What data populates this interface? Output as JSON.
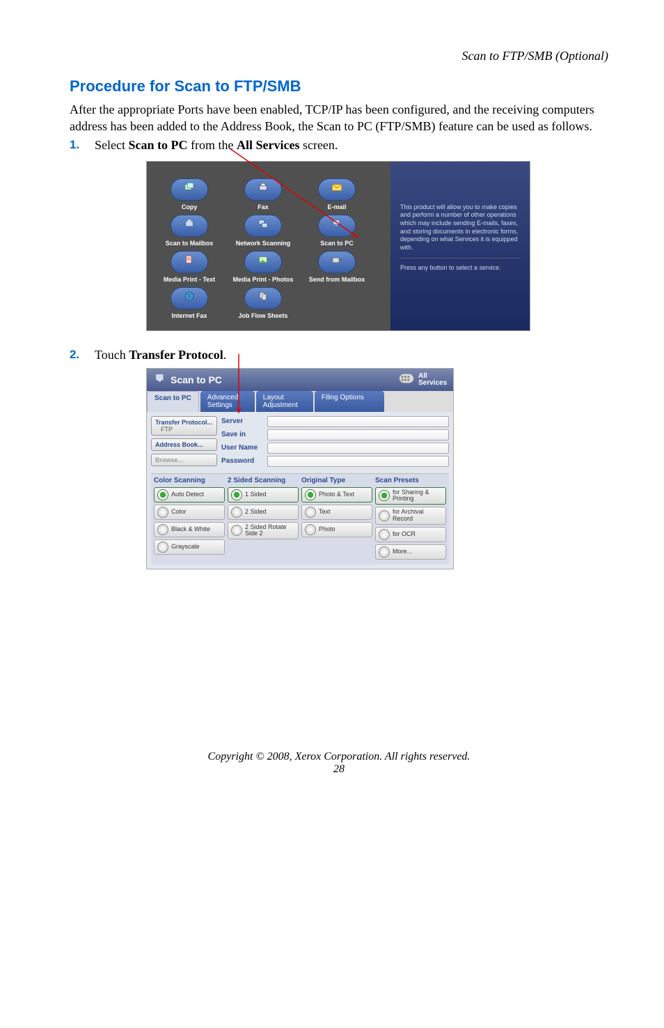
{
  "header": {
    "breadcrumb": "Scan to FTP/SMB (Optional)"
  },
  "section": {
    "title": "Procedure for Scan to FTP/SMB",
    "intro": "After the appropriate Ports have been enabled, TCP/IP has been configured, and the receiving computers address has been added to the Address Book, the Scan to PC (FTP/SMB) feature can be used as follows."
  },
  "steps": {
    "s1": {
      "num": "1.",
      "pre": "Select ",
      "bold1": "Scan to PC",
      "mid": " from the ",
      "bold2": "All Services",
      "post": " screen."
    },
    "s2": {
      "num": "2.",
      "pre": "Touch ",
      "bold1": "Transfer Protocol",
      "post": "."
    }
  },
  "all_services": {
    "items": [
      {
        "label": "Copy"
      },
      {
        "label": "Fax"
      },
      {
        "label": "E-mail"
      },
      {
        "label": "Scan to Mailbox"
      },
      {
        "label": "Network Scanning"
      },
      {
        "label": "Scan to PC"
      },
      {
        "label": "Media Print - Text"
      },
      {
        "label": "Media Print - Photos"
      },
      {
        "label": "Send from Mailbox"
      },
      {
        "label": "Internet Fax"
      },
      {
        "label": "Job Flow Sheets"
      }
    ],
    "info1": "This product will allow you to make copies and perform a number of other operations which may include sending E-mails, faxes, and storing documents in electronic forms, depending on what Services it is equipped with.",
    "info2": "Press any button to select a service."
  },
  "scan_pc": {
    "title": "Scan to PC",
    "all_services_btn": "All Services",
    "tabs": [
      "Scan to PC",
      "Advanced Settings",
      "Layout Adjustment",
      "Filing Options"
    ],
    "left_buttons": {
      "protocol": "Transfer Protocol...",
      "protocol_val": "FTP",
      "address": "Address Book...",
      "browse": "Browse..."
    },
    "fields": [
      "Server",
      "Save in",
      "User Name",
      "Password"
    ],
    "columns": {
      "color": {
        "head": "Color Scanning",
        "opts": [
          "Auto Detect",
          "Color",
          "Black & White",
          "Grayscale"
        ]
      },
      "sided": {
        "head": "2 Sided Scanning",
        "opts": [
          "1 Sided",
          "2 Sided",
          "2 Sided Rotate Side 2"
        ]
      },
      "orig": {
        "head": "Original Type",
        "opts": [
          "Photo & Text",
          "Text",
          "Photo"
        ]
      },
      "preset": {
        "head": "Scan Presets",
        "opts": [
          "for Sharing & Printing",
          "for Archival Record",
          "for OCR",
          "More..."
        ]
      }
    }
  },
  "footer": {
    "copyright": "Copyright © 2008, Xerox Corporation. All rights reserved.",
    "page": "28"
  }
}
